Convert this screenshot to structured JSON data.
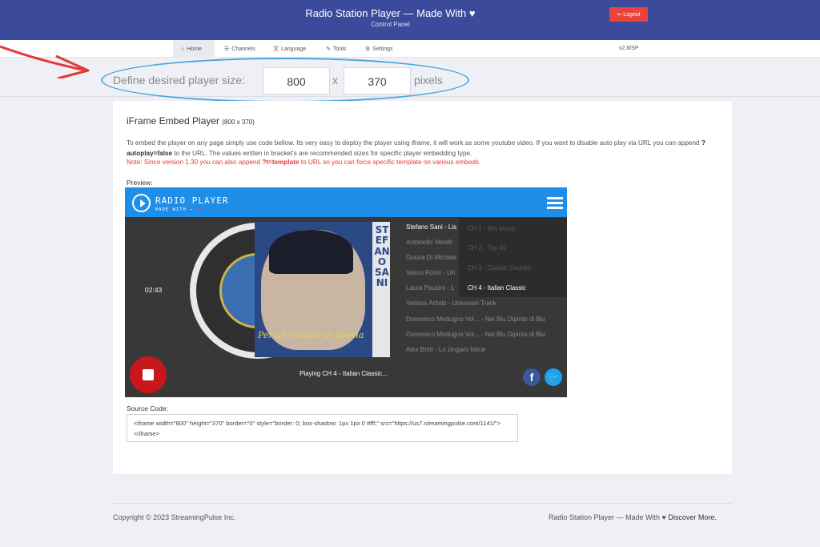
{
  "header": {
    "title": "Radio Station Player — Made With ♥",
    "subtitle": "Control Panel",
    "logout_label": "Logout"
  },
  "nav": {
    "items": [
      {
        "label": "Home",
        "icon": "home-icon",
        "active": true
      },
      {
        "label": "Channels",
        "icon": "list-icon"
      },
      {
        "label": "Language",
        "icon": "language-icon"
      },
      {
        "label": "Tools",
        "icon": "wrench-icon"
      },
      {
        "label": "Settings",
        "icon": "gears-icon"
      }
    ],
    "version": "v2.8/SP"
  },
  "size": {
    "label": "Define desired player size:",
    "width": "800",
    "separator": "x",
    "height": "370",
    "unit": "pixels"
  },
  "embed": {
    "title": "iFrame Embed Player",
    "dims": "(800 x 370)",
    "desc_1": "To embed the player on any page simply use code bellow. Its very easy to deploy the player using iframe, it will work as some youtube video. If you want to disable auto play via URL you can append ",
    "desc_code": "?autoplay=false",
    "desc_2": " to the URL. The values written in bracket's are recommended sizes for specific player embedding type.",
    "note_1": "Note: Since version 1.30 you can also append ",
    "note_code": "?t=template",
    "note_2": " to URL so you can force specific template on various embeds.",
    "preview_label": "Preview:",
    "source_label": "Source Code:",
    "source_code": "<iframe width=\"800\" height=\"370\" border=\"0\" style=\"border: 0; box-shadow: 1px 1px 0 #fff;\" src=\"https://us7.streamingpulse.com/1141/\"></iframe>"
  },
  "player": {
    "title": "RADIO PLAYER",
    "subtitle": "MADE WITH —",
    "heart": "♥",
    "time": "02:43",
    "playing": "Playing CH 4 - Italian Classic...",
    "cover_vertical": "STEFANO SANI",
    "cover_script": "Per un minuto di poesia",
    "playlist": [
      "Stefano Sani - Lis",
      "Antonello Vendit",
      "Grazia Di Michele",
      "Vasco Rossi - Un",
      "Laura Pausini - L",
      "Various Artists - Unknown Track",
      "Domenico Modugno Vol... - Nel Blu Dipinto di Blu",
      "Domenico Modugno Vol... - Nel Blu Dipinto di Blu",
      "Alex Britti - Lo zingaro felice"
    ],
    "channels": [
      "CH 1 - 90s Music",
      "CH 2 - Top 40",
      "CH 3 - Classic Country",
      "CH 4 - Italian Classic"
    ],
    "active_channel_index": 3
  },
  "footer": {
    "copyright": "Copyright © 2023 StreamingPulse Inc.",
    "right_1": "Radio Station Player — Made With ♥",
    "right_2": "Discover More."
  }
}
